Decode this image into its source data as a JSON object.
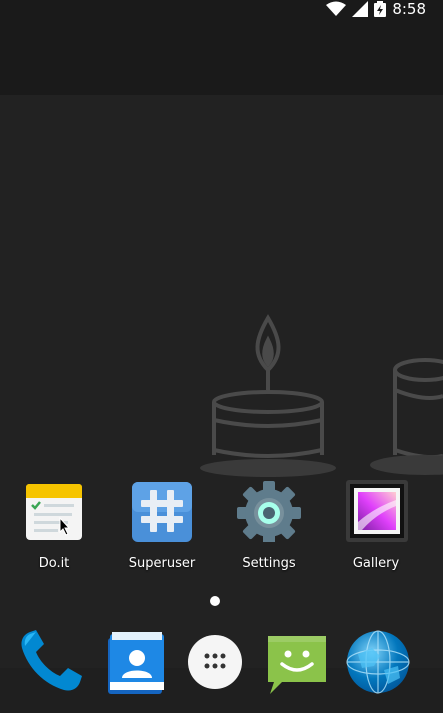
{
  "status_bar": {
    "time": "8:58",
    "icons": [
      "wifi-icon",
      "cell-signal-icon",
      "battery-charging-icon"
    ]
  },
  "wallpaper": {
    "description_icons": [
      "candle-cake-icon"
    ]
  },
  "apps": [
    {
      "label": "Do.it",
      "icon": "doit-icon"
    },
    {
      "label": "Superuser",
      "icon": "superuser-icon"
    },
    {
      "label": "Settings",
      "icon": "settings-icon"
    },
    {
      "label": "Gallery",
      "icon": "gallery-icon"
    }
  ],
  "page_indicator": {
    "pages": 1,
    "active": 1
  },
  "dock": [
    {
      "icon": "phone-icon"
    },
    {
      "icon": "contacts-icon"
    },
    {
      "icon": "app-drawer-icon"
    },
    {
      "icon": "messaging-icon"
    },
    {
      "icon": "browser-globe-icon"
    }
  ],
  "colors": {
    "background": "#222222",
    "status_bar": "#1a1a1a",
    "text": "#ffffff",
    "wallpaper_art": "#4a4a4a"
  }
}
